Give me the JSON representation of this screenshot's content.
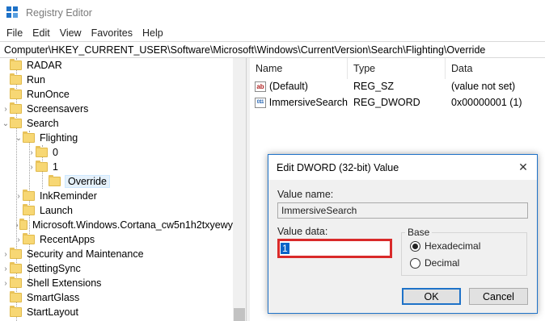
{
  "window": {
    "title": "Registry Editor"
  },
  "menu": [
    "File",
    "Edit",
    "View",
    "Favorites",
    "Help"
  ],
  "address": "Computer\\HKEY_CURRENT_USER\\Software\\Microsoft\\Windows\\CurrentVersion\\Search\\Flighting\\Override",
  "tree": [
    {
      "label": "RADAR",
      "chevron": ""
    },
    {
      "label": "Run",
      "chevron": ""
    },
    {
      "label": "RunOnce",
      "chevron": ""
    },
    {
      "label": "Screensavers",
      "chevron": "›"
    },
    {
      "label": "Search",
      "chevron": "⌄"
    },
    {
      "label": "Flighting",
      "chevron": "⌄"
    },
    {
      "label": "0",
      "chevron": "›"
    },
    {
      "label": "1",
      "chevron": "›"
    },
    {
      "label": "Override",
      "chevron": ""
    },
    {
      "label": "InkReminder",
      "chevron": "›"
    },
    {
      "label": "Launch",
      "chevron": ""
    },
    {
      "label": "Microsoft.Windows.Cortana_cw5n1h2txyewy",
      "chevron": "›"
    },
    {
      "label": "RecentApps",
      "chevron": "›"
    },
    {
      "label": "Security and Maintenance",
      "chevron": "›"
    },
    {
      "label": "SettingSync",
      "chevron": "›"
    },
    {
      "label": "Shell Extensions",
      "chevron": "›"
    },
    {
      "label": "SmartGlass",
      "chevron": ""
    },
    {
      "label": "StartLayout",
      "chevron": ""
    }
  ],
  "list": {
    "columns": [
      "Name",
      "Type",
      "Data"
    ],
    "rows": [
      {
        "icon": "ab",
        "name": "(Default)",
        "type": "REG_SZ",
        "data": "(value not set)"
      },
      {
        "icon": "011",
        "name": "ImmersiveSearch",
        "type": "REG_DWORD",
        "data": "0x00000001 (1)"
      }
    ]
  },
  "dialog": {
    "title": "Edit DWORD (32-bit) Value",
    "close_glyph": "✕",
    "value_name_label": "Value name:",
    "value_name": "ImmersiveSearch",
    "value_data_label": "Value data:",
    "value_data": "1",
    "base_label": "Base",
    "hex_label": "Hexadecimal",
    "dec_label": "Decimal",
    "ok_label": "OK",
    "cancel_label": "Cancel"
  },
  "colors": {
    "accent": "#1e72c8",
    "highlight_border": "#d92a2a",
    "folder": "#f7d774"
  }
}
